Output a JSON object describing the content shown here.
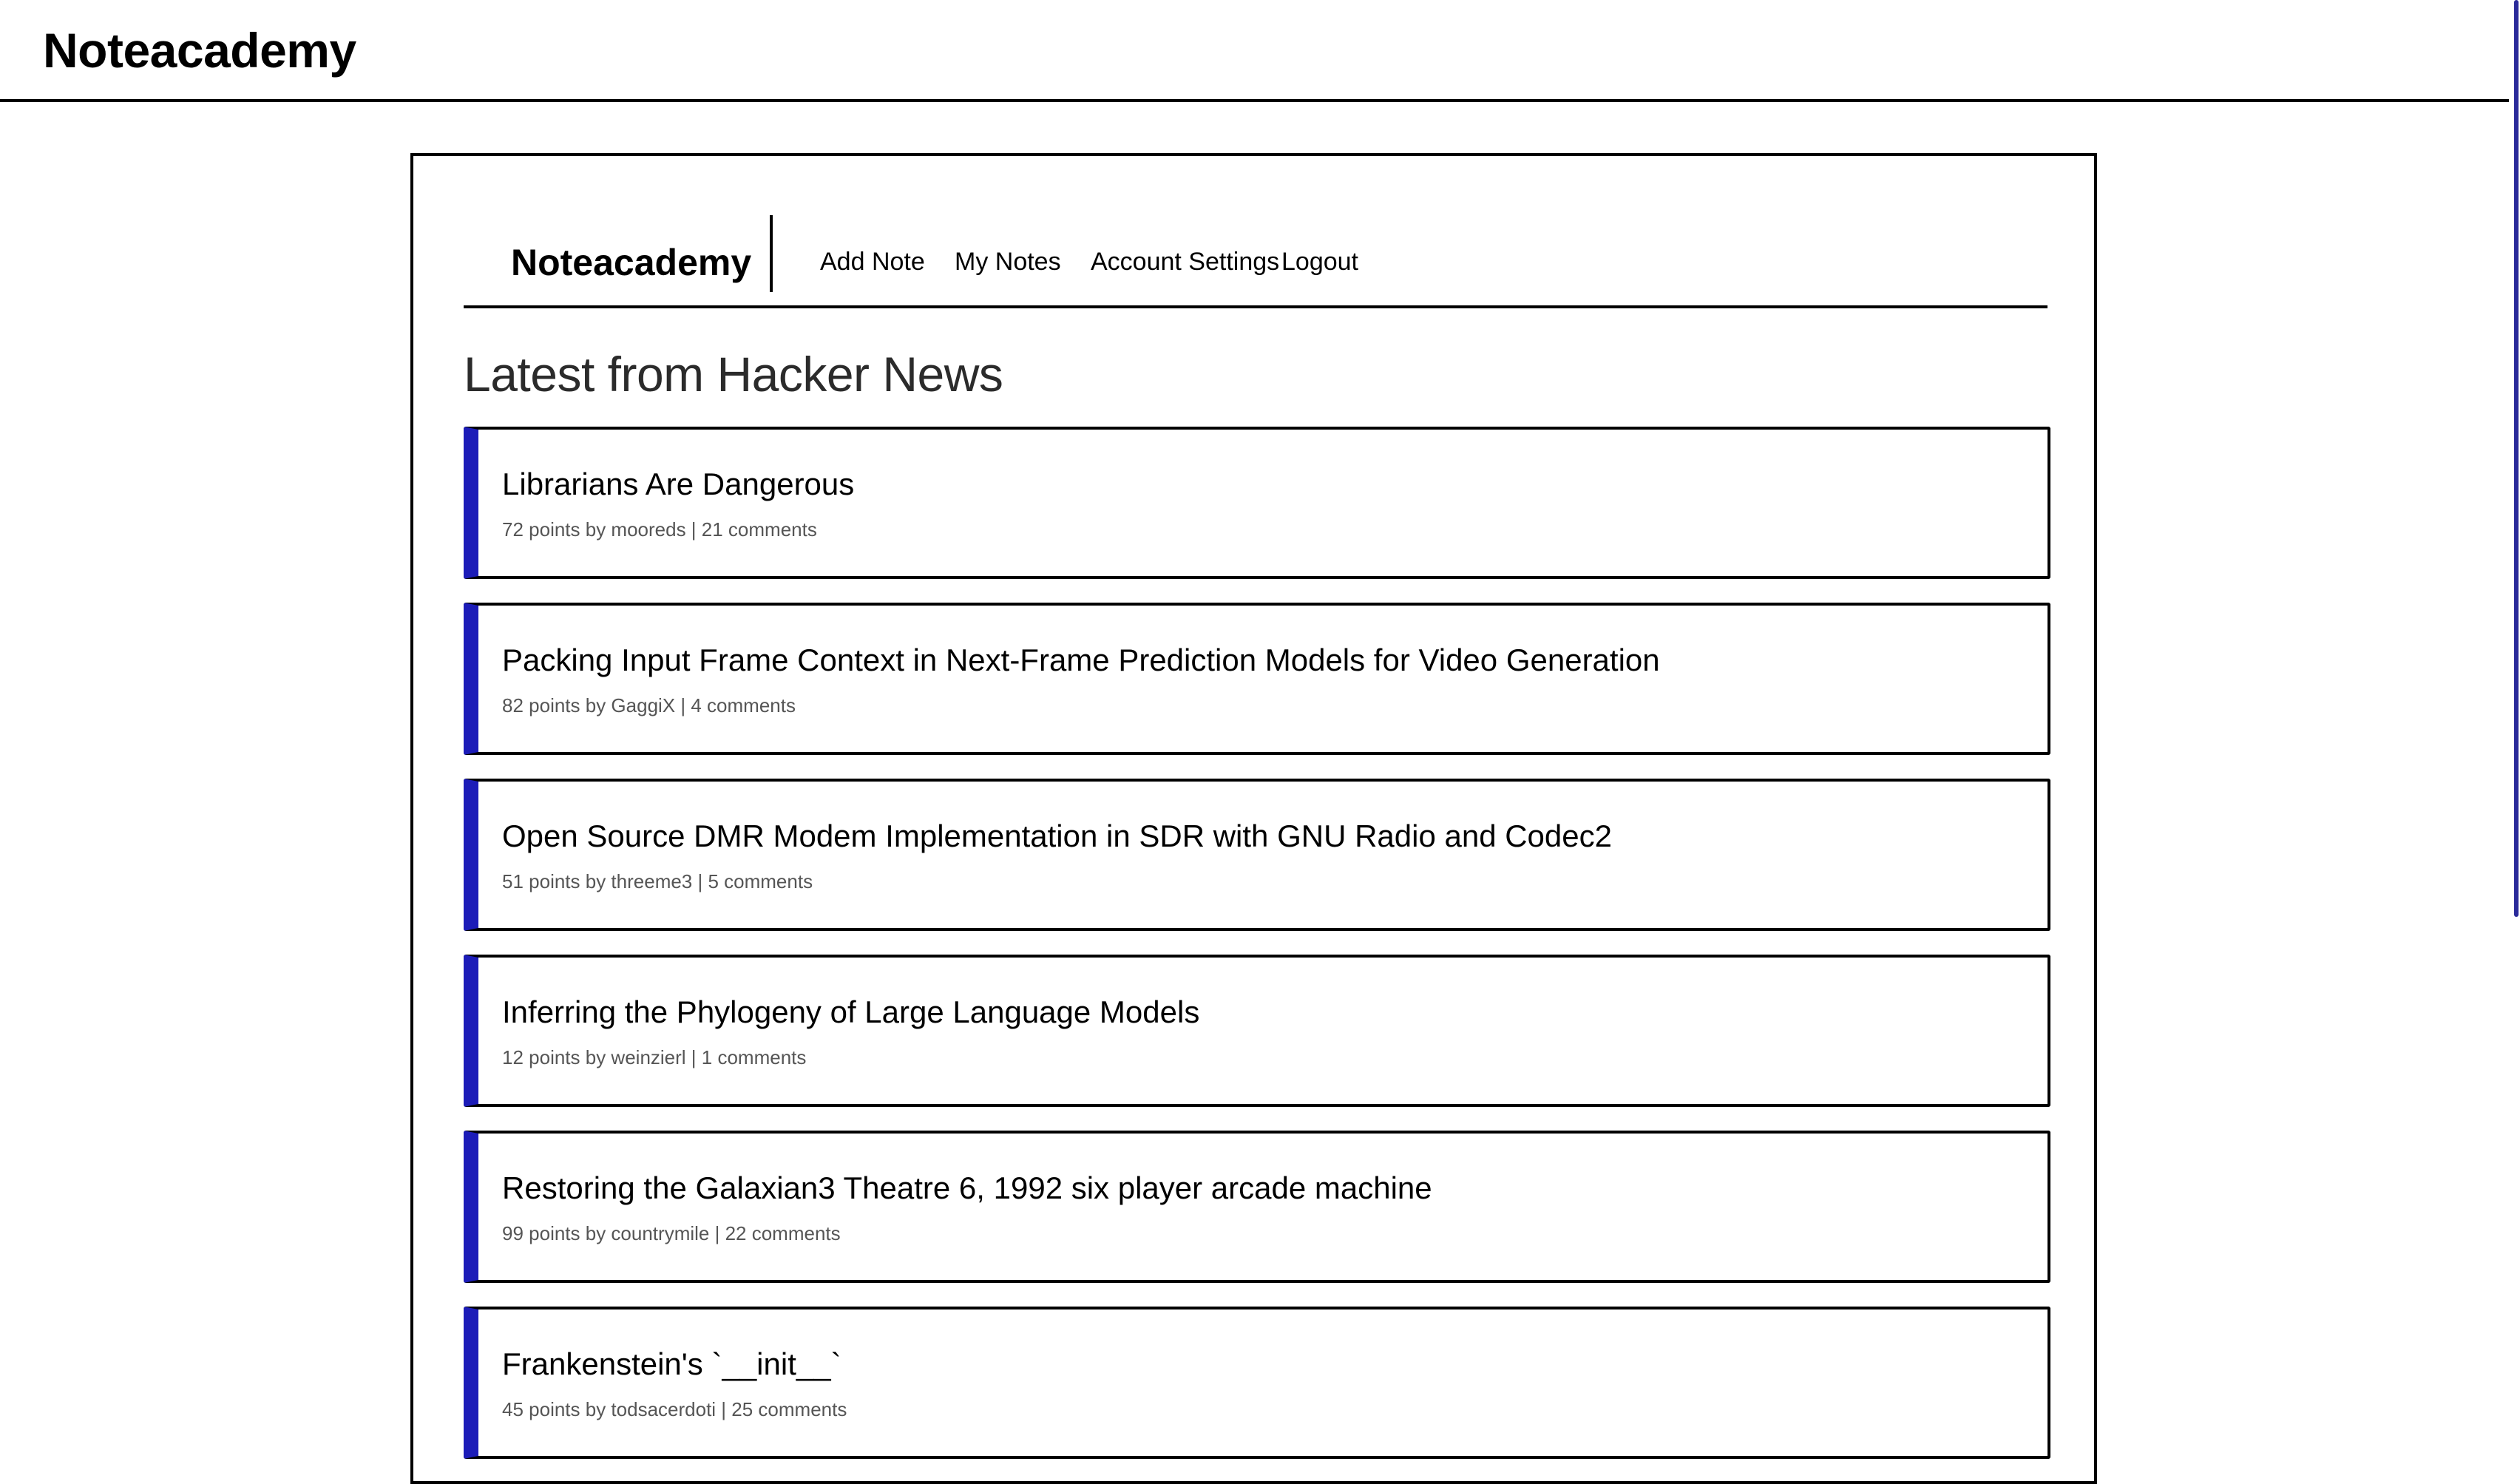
{
  "header": {
    "site_title": "Noteacademy"
  },
  "nav": {
    "brand": "Noteacademy",
    "links": [
      {
        "label": "Add Note"
      },
      {
        "label": "My Notes"
      },
      {
        "label": "Account Settings"
      },
      {
        "label": "Logout"
      }
    ]
  },
  "main": {
    "heading": "Latest from Hacker News",
    "stories": [
      {
        "title": "Librarians Are Dangerous",
        "meta": "72 points by mooreds | 21 comments"
      },
      {
        "title": "Packing Input Frame Context in Next-Frame Prediction Models for Video Generation",
        "meta": "82 points by GaggiX | 4 comments"
      },
      {
        "title": "Open Source DMR Modem Implementation in SDR with GNU Radio and Codec2",
        "meta": "51 points by threeme3 | 5 comments"
      },
      {
        "title": "Inferring the Phylogeny of Large Language Models",
        "meta": "12 points by weinzierl | 1 comments"
      },
      {
        "title": "Restoring the Galaxian3 Theatre 6, 1992 six player arcade machine",
        "meta": "99 points by countrymile | 22 comments"
      },
      {
        "title": "Frankenstein's `__init__`",
        "meta": "45 points by todsacerdoti | 25 comments"
      }
    ]
  },
  "colors": {
    "accent": "#1c1cb8",
    "meta_text": "#555555",
    "heading_text": "#2b2b2b"
  }
}
